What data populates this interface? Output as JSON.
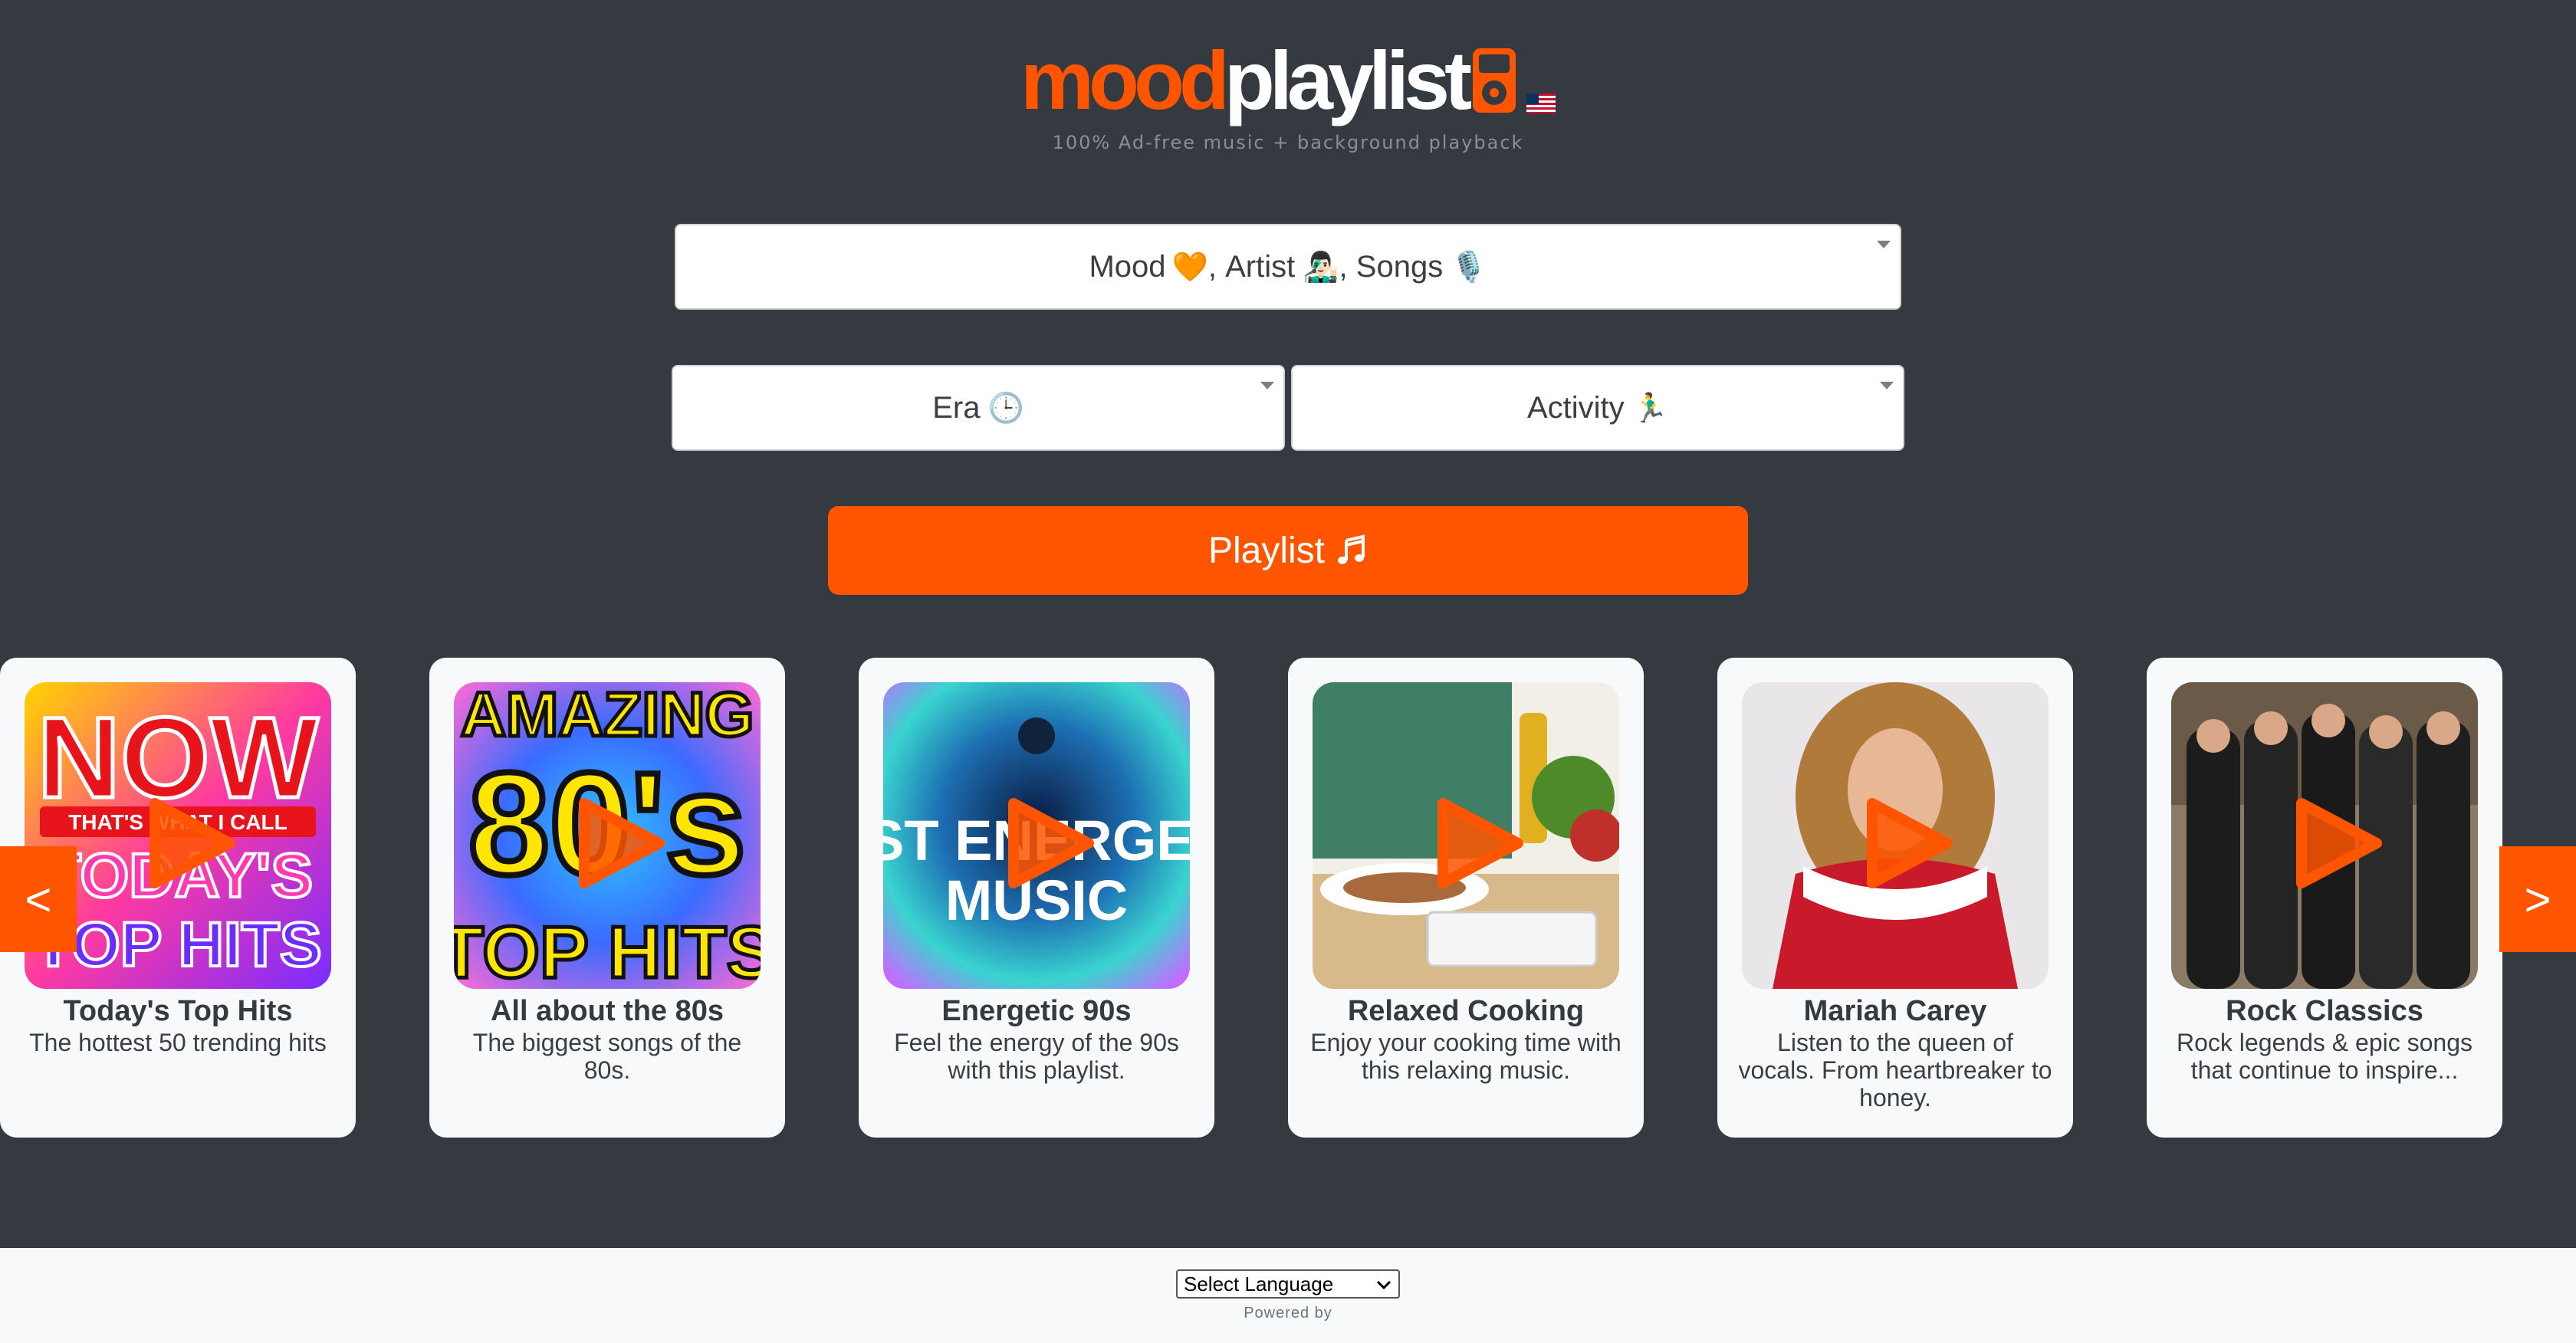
{
  "header": {
    "logo_mood": "mood",
    "logo_playlist": "playlist",
    "tagline": "100% Ad-free music + background playback",
    "brand_color": "#ff5500",
    "flag_icon": "us-flag-icon"
  },
  "filters": {
    "mood_label": "Mood",
    "mood_emoji": "🧡",
    "artist_label": "Artist",
    "artist_emoji": "👨🏻‍🎤",
    "songs_label": "Songs",
    "songs_emoji": "🎙️",
    "era_label": "Era",
    "era_emoji": "🕒",
    "activity_label": "Activity",
    "activity_emoji": "🏃‍♂️"
  },
  "playlist_button": {
    "label": "Playlist",
    "icon": "music-note-icon"
  },
  "carousel": {
    "prev_label": "<",
    "next_label": ">",
    "cards": [
      {
        "title": "Today's Top Hits",
        "desc": "The hottest 50 trending hits",
        "art_text_1": "NOW",
        "art_text_2": "THAT'S WHAT I CALL",
        "art_text_3": "TODAY'S",
        "art_text_4": "TOP HITS"
      },
      {
        "title": "All about the 80s",
        "desc": "The biggest songs of the 80s.",
        "art_text_1": "AMAZING",
        "art_text_2": "80's",
        "art_text_3": "TOP HITS"
      },
      {
        "title": "Energetic 90s",
        "desc": "Feel the energy of the 90s with this playlist.",
        "art_text_1": "BEST ENERGETIC",
        "art_text_2": "MUSIC"
      },
      {
        "title": "Relaxed Cooking",
        "desc": "Enjoy your cooking time with this relaxing music."
      },
      {
        "title": "Mariah Carey",
        "desc": "Listen to the queen of vocals. From heartbreaker to honey."
      },
      {
        "title": "Rock Classics",
        "desc": "Rock legends & epic songs that continue to inspire..."
      }
    ]
  },
  "footer": {
    "language_select": "Select Language",
    "powered_by": "Powered by"
  }
}
